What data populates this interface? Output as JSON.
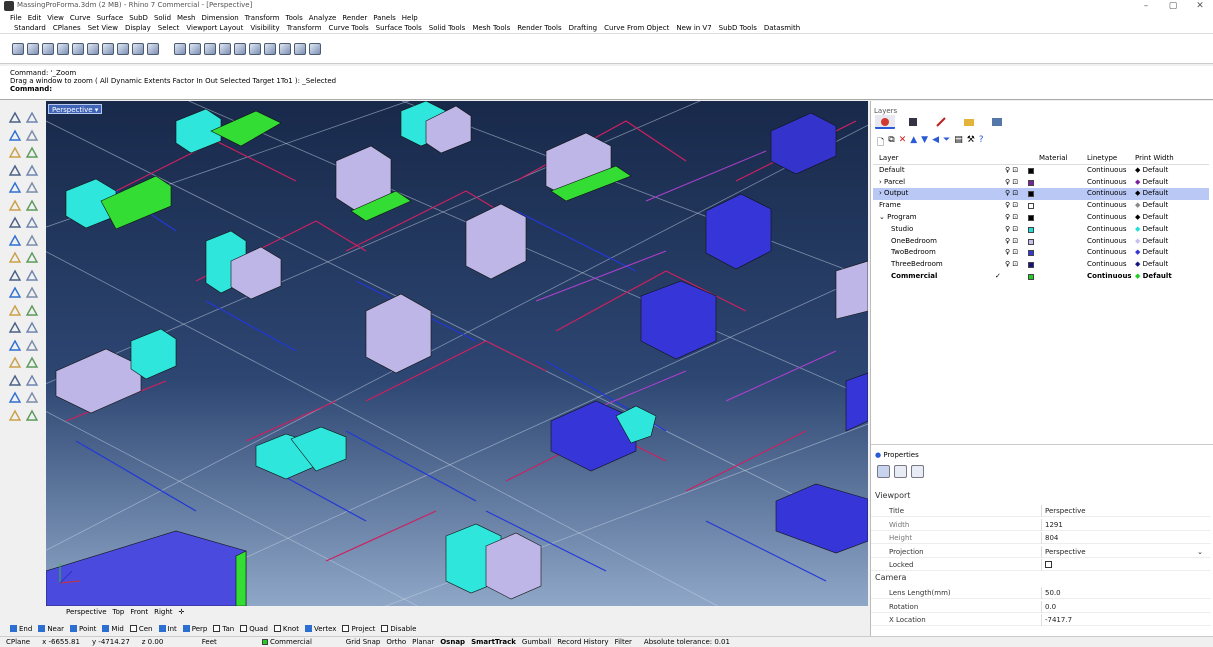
{
  "window": {
    "title": "MassingProForma.3dm (2 MB) - Rhino 7 Commercial - [Perspective]",
    "controls": [
      "–",
      "▢",
      "✕"
    ]
  },
  "menu": [
    "File",
    "Edit",
    "View",
    "Curve",
    "Surface",
    "SubD",
    "Solid",
    "Mesh",
    "Dimension",
    "Transform",
    "Tools",
    "Analyze",
    "Render",
    "Panels",
    "Help"
  ],
  "toolbar_tabs": [
    "Standard",
    "CPlanes",
    "Set View",
    "Display",
    "Select",
    "Viewport Layout",
    "Visibility",
    "Transform",
    "Curve Tools",
    "Surface Tools",
    "Solid Tools",
    "Mesh Tools",
    "Render Tools",
    "Drafting",
    "Curve From Object",
    "New in V7",
    "SubD Tools",
    "Datasmith"
  ],
  "command_area": {
    "line1": "Command: '_Zoom",
    "line2": "Drag a window to zoom ( All  Dynamic  Extents  Factor  In  Out  Selected  Target  1To1 ): _Selected",
    "prompt": "Command:"
  },
  "viewport": {
    "label": "Perspective",
    "tabs": [
      "Perspective",
      "Top",
      "Front",
      "Right",
      "✛"
    ]
  },
  "layers": {
    "panel_title": "Layers",
    "headers": {
      "layer": "Layer",
      "material": "Material",
      "linetype": "Linetype",
      "print_width": "Print Width"
    },
    "rows": [
      {
        "name": "Default",
        "indent": 0,
        "expander": "",
        "swatch": "#000000",
        "linetype": "Continuous",
        "pw_swatch": "#000000",
        "print_width": "Default",
        "selected": false,
        "current": false
      },
      {
        "name": "Parcel",
        "indent": 0,
        "expander": "›",
        "swatch": "#7a1fa0",
        "linetype": "Continuous",
        "pw_swatch": "#7a1fa0",
        "print_width": "Default",
        "selected": false,
        "current": false
      },
      {
        "name": "Output",
        "indent": 0,
        "expander": "›",
        "swatch": "#000000",
        "linetype": "Continuous",
        "pw_swatch": "#000000",
        "print_width": "Default",
        "selected": true,
        "current": false
      },
      {
        "name": "Frame",
        "indent": 0,
        "expander": "",
        "swatch": "#ffffff",
        "linetype": "Continuous",
        "pw_swatch": "#ffffff",
        "print_width": "Default",
        "selected": false,
        "current": false
      },
      {
        "name": "Program",
        "indent": 0,
        "expander": "⌄",
        "swatch": "#000000",
        "linetype": "Continuous",
        "pw_swatch": "#000000",
        "print_width": "Default",
        "selected": false,
        "current": false
      },
      {
        "name": "Studio",
        "indent": 1,
        "expander": "",
        "swatch": "#1ee0d8",
        "linetype": "Continuous",
        "pw_swatch": "#1ee0d8",
        "print_width": "Default",
        "selected": false,
        "current": false
      },
      {
        "name": "OneBedroom",
        "indent": 1,
        "expander": "",
        "swatch": "#c7c0ef",
        "linetype": "Continuous",
        "pw_swatch": "#c7c0ef",
        "print_width": "Default",
        "selected": false,
        "current": false
      },
      {
        "name": "TwoBedroom",
        "indent": 1,
        "expander": "",
        "swatch": "#3636d8",
        "linetype": "Continuous",
        "pw_swatch": "#3636d8",
        "print_width": "Default",
        "selected": false,
        "current": false
      },
      {
        "name": "ThreeBedroom",
        "indent": 1,
        "expander": "",
        "swatch": "#141480",
        "linetype": "Continuous",
        "pw_swatch": "#141480",
        "print_width": "Default",
        "selected": false,
        "current": false
      },
      {
        "name": "Commercial",
        "indent": 1,
        "expander": "",
        "swatch": "#22cc22",
        "linetype": "Continuous",
        "pw_swatch": "#22cc22",
        "print_width": "Default",
        "selected": false,
        "current": true
      }
    ]
  },
  "properties": {
    "panel_title": "Properties",
    "section_viewport": "Viewport",
    "viewport_rows": [
      {
        "key": "Title",
        "value": "Perspective"
      },
      {
        "key": "Width",
        "value": "1291"
      },
      {
        "key": "Height",
        "value": "804"
      },
      {
        "key": "Projection",
        "value": "Perspective"
      },
      {
        "key": "Locked",
        "value": ""
      }
    ],
    "section_camera": "Camera",
    "camera_rows": [
      {
        "key": "Lens Length(mm)",
        "value": "50.0"
      },
      {
        "key": "Rotation",
        "value": "0.0"
      },
      {
        "key": "X Location",
        "value": "-7417.7"
      }
    ]
  },
  "osnap": [
    {
      "label": "End",
      "on": true
    },
    {
      "label": "Near",
      "on": true
    },
    {
      "label": "Point",
      "on": true
    },
    {
      "label": "Mid",
      "on": true
    },
    {
      "label": "Cen",
      "on": false
    },
    {
      "label": "Int",
      "on": true
    },
    {
      "label": "Perp",
      "on": true
    },
    {
      "label": "Tan",
      "on": false
    },
    {
      "label": "Quad",
      "on": false
    },
    {
      "label": "Knot",
      "on": false
    },
    {
      "label": "Vertex",
      "on": true
    },
    {
      "label": "Project",
      "on": false
    },
    {
      "label": "Disable",
      "on": false
    }
  ],
  "status": {
    "cplane": "CPlane",
    "x": "x -6655.81",
    "y": "y -4714.27",
    "z": "z 0.00",
    "units": "Feet",
    "layer": "Commercial",
    "layer_color": "#22cc22",
    "toggles": [
      "Grid Snap",
      "Ortho",
      "Planar",
      "Osnap",
      "SmartTrack",
      "Gumball",
      "Record History",
      "Filter"
    ],
    "tolerance": "Absolute tolerance: 0.01"
  }
}
